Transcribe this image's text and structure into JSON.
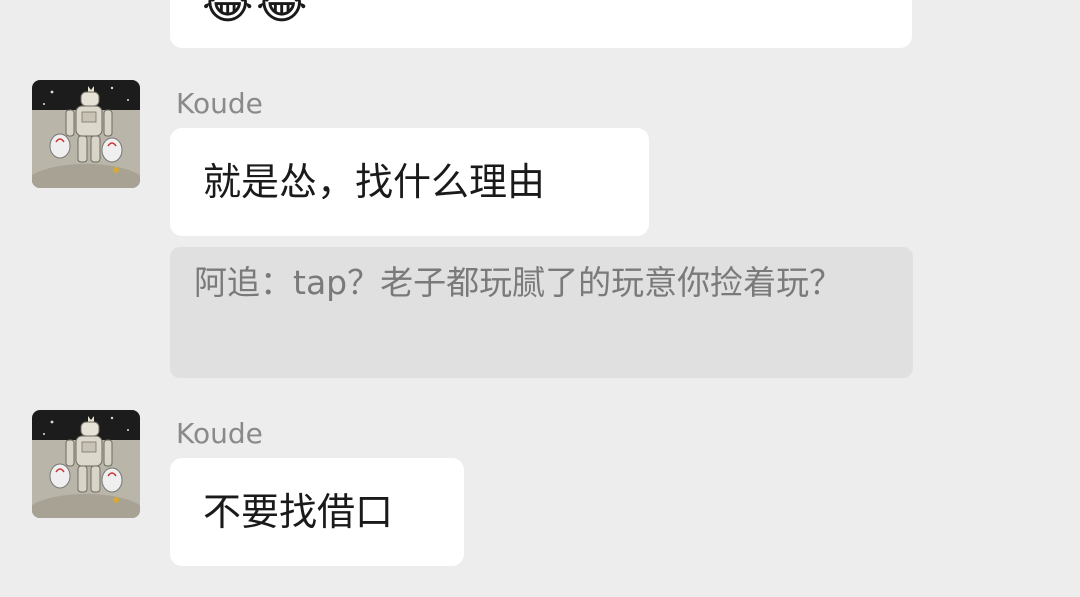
{
  "chat": {
    "top_message": {
      "emojis": [
        "😂",
        "😂"
      ]
    },
    "messages": [
      {
        "sender": "Koude",
        "text": "就是怂，找什么理由",
        "quote": "阿追：tap？老子都玩腻了的玩意你捡着玩？"
      },
      {
        "sender": "Koude",
        "text": "不要找借口"
      }
    ]
  },
  "colors": {
    "background": "#ededed",
    "bubble": "#ffffff",
    "quote_bg": "#e0e0e0",
    "sender_text": "#8a8a8a"
  }
}
